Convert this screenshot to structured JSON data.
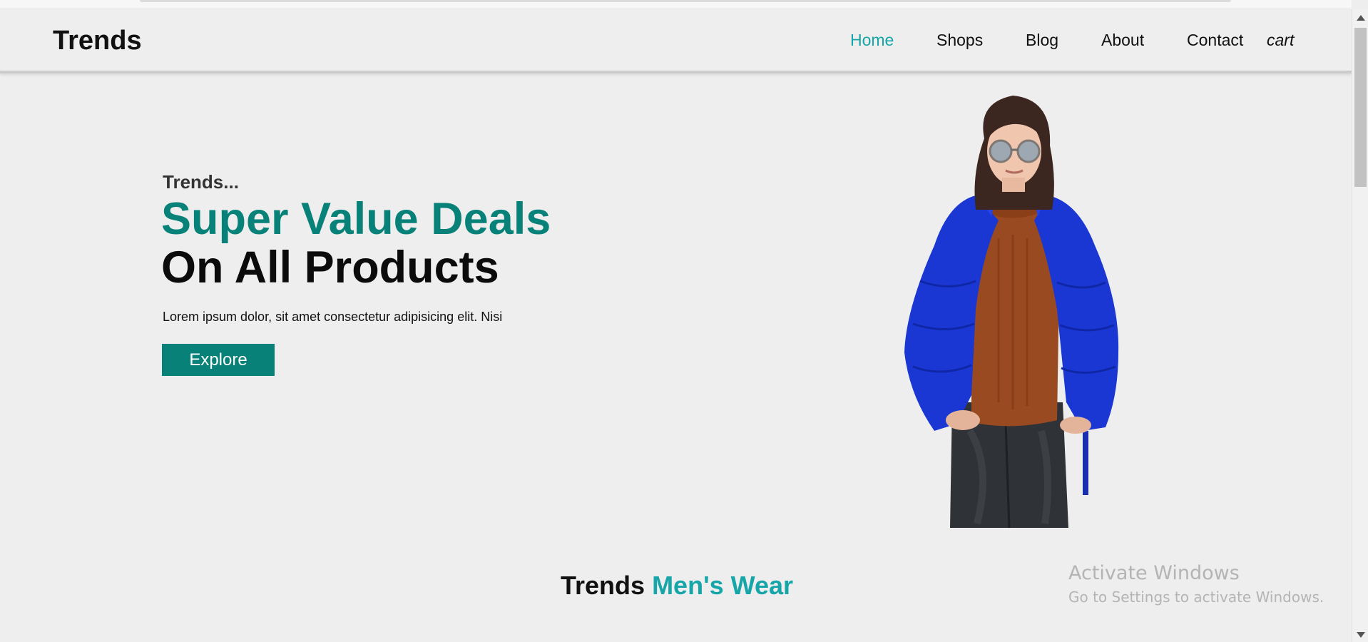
{
  "header": {
    "logo": "Trends",
    "nav": [
      {
        "label": "Home",
        "active": true
      },
      {
        "label": "Shops"
      },
      {
        "label": "Blog"
      },
      {
        "label": "About"
      },
      {
        "label": "Contact"
      },
      {
        "label": "cart"
      }
    ]
  },
  "hero": {
    "eyebrow": "Trends...",
    "headline_1": "Super Value Deals",
    "headline_2": "On All Products",
    "description": "Lorem ipsum dolor, sit amet consectetur adipisicing elit. Nisi",
    "cta_label": "Explore",
    "image_icon": "woman-in-blue-puffer-jacket-photo"
  },
  "section": {
    "title_part_1": "Trends",
    "title_part_2": "Men's Wear"
  },
  "watermark": {
    "line_1": "Activate Windows",
    "line_2": "Go to Settings to activate Windows."
  },
  "colors": {
    "accent": "#088178",
    "nav_active": "#16a5a8",
    "background": "#eeeeee"
  }
}
